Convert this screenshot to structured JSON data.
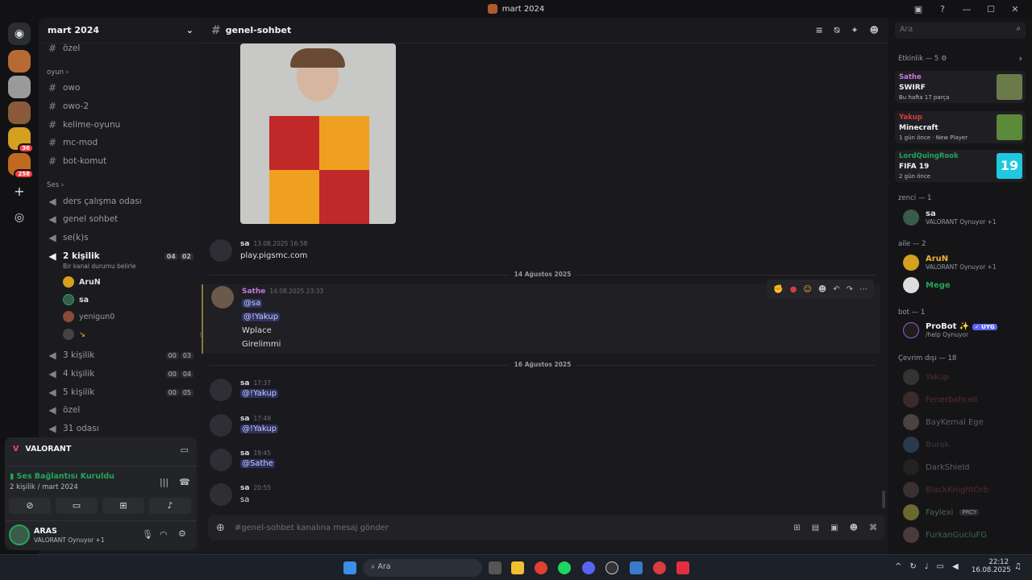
{
  "window": {
    "title": "mart 2024"
  },
  "guild": {
    "name": "mart 2024"
  },
  "channels": {
    "ozel_top": "özel",
    "cat_oyun": "oyun",
    "text": [
      "owo",
      "owo-2",
      "kelime-oyunu",
      "mc-mod",
      "bot-komut"
    ],
    "cat_ses": "Ses",
    "voice": [
      "ders çalışma odası",
      "genel sohbet",
      "se(k)s"
    ],
    "active_voice": {
      "name": "2 kişilik",
      "status": "Bir kanal durumu belirle",
      "c1": "04",
      "c2": "02"
    },
    "voice_users": [
      "AruN",
      "sa",
      "yenigun0",
      "↘"
    ],
    "more_voice": [
      {
        "name": "3 kişilik",
        "c1": "00",
        "c2": "03"
      },
      {
        "name": "4 kişilik",
        "c1": "00",
        "c2": "04"
      },
      {
        "name": "5 kişilik",
        "c1": "00",
        "c2": "05"
      }
    ],
    "ozel_bottom": "özel",
    "odasi": "31 odası"
  },
  "voice_panel": {
    "game": "VALORANT",
    "status": "Ses Bağlantısı Kuruldu",
    "channel": "2 kişilik / mart 2024",
    "user": "ARAS",
    "user_activity": "VALORANT Oynuyor +1"
  },
  "main": {
    "channel": "genel-sohbet",
    "messages": {
      "m1": {
        "author": "sa",
        "time": "13.08.2025 16:58",
        "text": "play.pigsmc.com"
      },
      "d1": "14 Ağustos 2025",
      "m2": {
        "author": "Sathe",
        "time": "14.08.2025 23:33",
        "lines": [
          "@sa",
          "@!Yakup",
          "Wplace",
          "Girelimmi"
        ]
      },
      "d2": "16 Ağustos 2025",
      "m3": {
        "author": "sa",
        "time": "17:37",
        "text": "@!Yakup"
      },
      "m4": {
        "author": "sa",
        "time": "17:49",
        "text": "@!Yakup"
      },
      "m5": {
        "author": "sa",
        "time": "19:45",
        "text": "@Sathe"
      },
      "m6": {
        "author": "sa",
        "time": "20:55",
        "text": "sa"
      }
    },
    "input_placeholder": "#genel-sohbet kanalına mesaj gönder"
  },
  "search": {
    "placeholder": "Ara"
  },
  "members": {
    "activity_header": "Etkinlik — 5",
    "activities": [
      {
        "user": "Sathe",
        "game": "SWIRF",
        "sub": "Bu hafta 17 parça"
      },
      {
        "user": "Yakup",
        "game": "Minecraft",
        "sub": "1 gün önce",
        "extra": "New Player"
      },
      {
        "user": "LordQuingRook",
        "game": "FIFA 19",
        "sub": "2 gün önce"
      }
    ],
    "g_zenci": "zenci — 1",
    "zenci": [
      {
        "name": "sa",
        "sub": "VALORANT Oynuyor +1"
      }
    ],
    "g_aile": "aile — 2",
    "aile": [
      {
        "name": "AruN",
        "sub": "VALORANT Oynuyor +1"
      },
      {
        "name": "Mege",
        "sub": ""
      }
    ],
    "g_bot": "bot — 1",
    "bot": [
      {
        "name": "ProBot ✨",
        "tag": "✓ UYG",
        "sub": "/help Oynuyor"
      }
    ],
    "g_offline": "Çevrim dışı — 18",
    "offline": [
      "Yakup",
      "FenerbahceIl",
      "BayKemal Ege",
      "Burak",
      "DarkShield",
      "BlackKnightOrb",
      "Faylexi",
      "FurkanGucluFG"
    ],
    "faylexi_tag": "PRCY"
  },
  "taskbar": {
    "search": "Ara",
    "time": "22:12",
    "date": "16.08.2025"
  }
}
